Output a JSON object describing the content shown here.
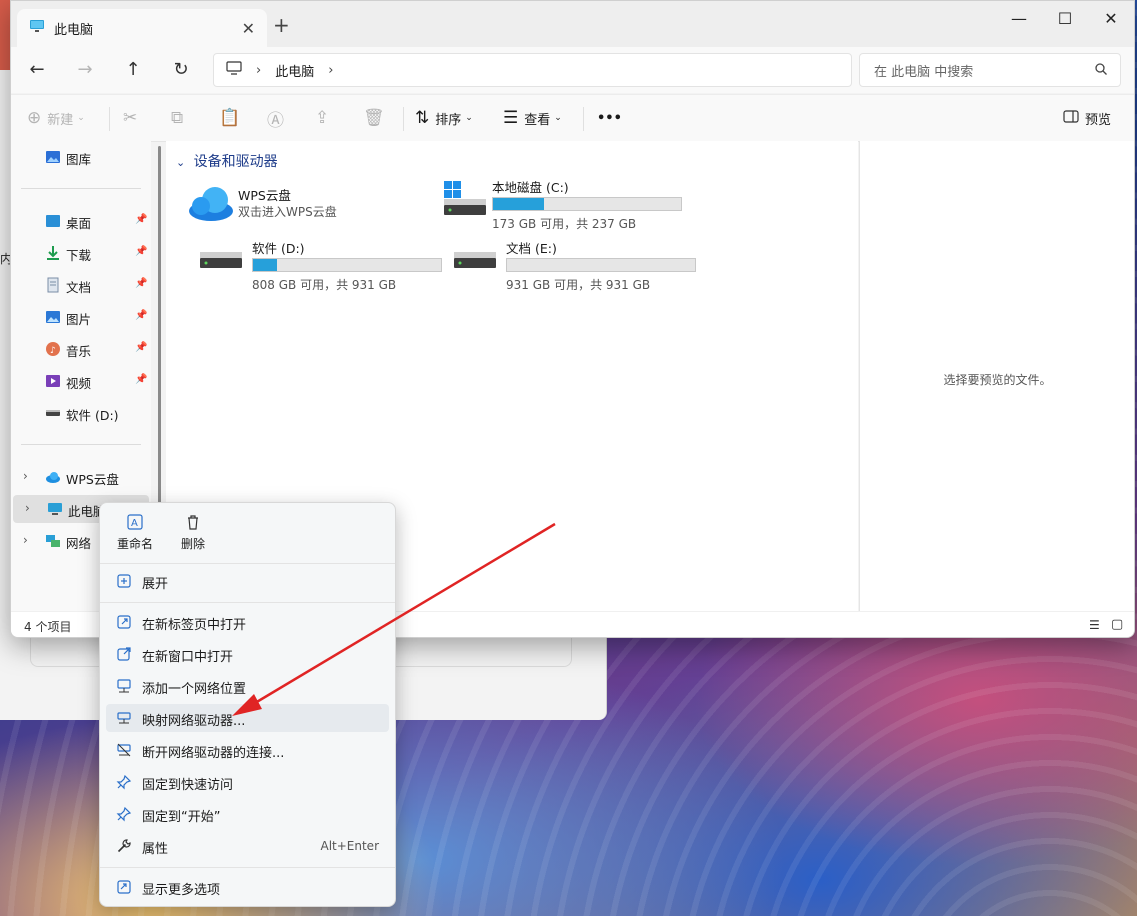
{
  "window": {
    "tab_title": "此电脑",
    "new_tab": "+",
    "close_tab": "✕"
  },
  "nav": {
    "crumb": "此电脑",
    "search_placeholder": "在 此电脑 中搜索"
  },
  "toolbar": {
    "new_label": "新建",
    "sort_label": "排序",
    "view_label": "查看",
    "more_label": "•••",
    "preview_label": "预览"
  },
  "sidebar": {
    "items": [
      {
        "label": "图库",
        "icon": "gallery-icon"
      },
      {
        "label": "桌面",
        "icon": "desktop-icon",
        "pinned": true
      },
      {
        "label": "下载",
        "icon": "download-icon",
        "pinned": true
      },
      {
        "label": "文档",
        "icon": "document-icon",
        "pinned": true
      },
      {
        "label": "图片",
        "icon": "picture-icon",
        "pinned": true
      },
      {
        "label": "音乐",
        "icon": "music-icon",
        "pinned": true
      },
      {
        "label": "视频",
        "icon": "video-icon",
        "pinned": true
      },
      {
        "label": "软件 (D:)",
        "icon": "drive-icon"
      },
      {
        "label": "WPS云盘",
        "icon": "cloud-icon"
      },
      {
        "label": "此电脑",
        "icon": "computer-icon",
        "selected": true
      },
      {
        "label": "网络",
        "icon": "network-icon"
      }
    ]
  },
  "content": {
    "section_title": "设备和驱动器",
    "drives": [
      {
        "name": "WPS云盘",
        "sub": "双击进入WPS云盘"
      },
      {
        "name": "本地磁盘 (C:)",
        "free": "173 GB 可用，共 237 GB",
        "used_fraction": 0.27
      },
      {
        "name": "软件 (D:)",
        "free": "808 GB 可用，共 931 GB",
        "used_fraction": 0.13
      },
      {
        "name": "文档 (E:)",
        "free": "931 GB 可用，共 931 GB",
        "used_fraction": 0.0
      }
    ]
  },
  "preview": {
    "message": "选择要预览的文件。"
  },
  "status": {
    "count": "4 个项目"
  },
  "context_menu": {
    "top": {
      "rename": "重命名",
      "delete": "删除"
    },
    "items": [
      {
        "label": "展开",
        "icon": "expand-icon"
      },
      {
        "label": "在新标签页中打开",
        "icon": "open-new-tab-icon"
      },
      {
        "label": "在新窗口中打开",
        "icon": "open-new-window-icon"
      },
      {
        "label": "添加一个网络位置",
        "icon": "add-network-location-icon"
      },
      {
        "label": "映射网络驱动器...",
        "icon": "map-network-drive-icon",
        "highlighted": true
      },
      {
        "label": "断开网络驱动器的连接...",
        "icon": "disconnect-network-drive-icon"
      },
      {
        "label": "固定到快速访问",
        "icon": "pin-icon"
      },
      {
        "label": "固定到“开始”",
        "icon": "pin-start-icon"
      },
      {
        "label": "属性",
        "icon": "wrench-icon",
        "shortcut": "Alt+Enter"
      },
      {
        "label": "显示更多选项",
        "icon": "more-options-icon"
      }
    ]
  },
  "background": {
    "partial_text": "内"
  },
  "colors": {
    "accent": "#26a0da",
    "arrow": "#e02424",
    "section_title": "#1e3c8a"
  }
}
